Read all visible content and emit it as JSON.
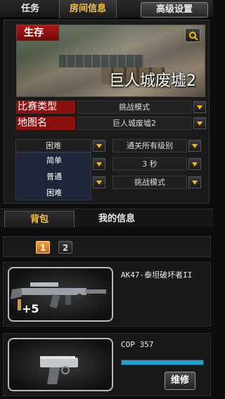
{
  "top_tabs": {
    "tasks": "任务",
    "room_info": "房间信息",
    "advanced": "高级设置"
  },
  "banner": {
    "mode_tag": "生存",
    "map_title": "巨人城废墟2"
  },
  "fields": {
    "match_type_label": "比赛类型",
    "match_type_value": "挑战模式",
    "map_name_label": "地图名",
    "map_name_value": "巨人城废墟2"
  },
  "selects": {
    "difficulty": "困难",
    "clear_levels": "通关所有级别",
    "time": "3 秒",
    "mode": "挑战模式"
  },
  "difficulty_options": [
    "简单",
    "普通",
    "困难"
  ],
  "bottom_tabs": {
    "backpack": "背包",
    "my_info": "我的信息"
  },
  "pages": [
    "1",
    "2"
  ],
  "weapons": [
    {
      "name": "AK47-泰坦破坏者II",
      "badge": "+5"
    },
    {
      "name": "COP 357",
      "durability": 1.0,
      "repair_label": "维修"
    }
  ],
  "colors": {
    "accent_red": "#8b1010",
    "gold": "#f5c000",
    "durability": "#1ea0d8"
  }
}
